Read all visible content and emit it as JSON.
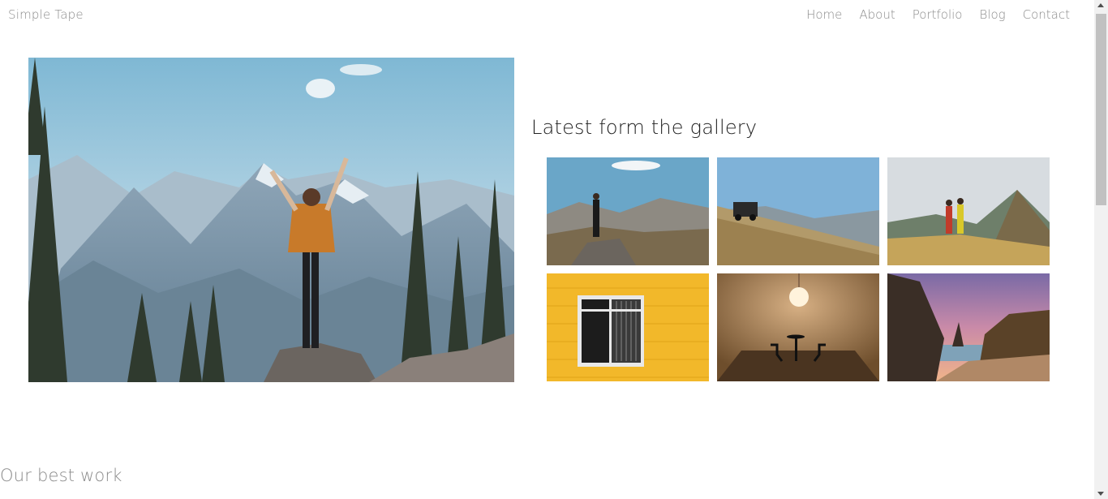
{
  "site": {
    "brand": "Simple Tape"
  },
  "nav": {
    "items": [
      "Home",
      "About",
      "Portfolio",
      "Blog",
      "Contact"
    ]
  },
  "hero": {
    "image": "mountain-summit-photo"
  },
  "gallery": {
    "title": "Latest form the gallery",
    "thumbnails": [
      "hiker-on-rock-photo",
      "offroad-car-hillside-photo",
      "couple-hiking-photo",
      "yellow-wall-window-photo",
      "pendant-lamp-room-photo",
      "coastal-cliffs-sunset-photo"
    ]
  },
  "sections": {
    "best_work_title": "Our best work"
  },
  "colors": {
    "nav_text": "#8a8a8a",
    "heading": "#222222",
    "background": "#ffffff"
  }
}
